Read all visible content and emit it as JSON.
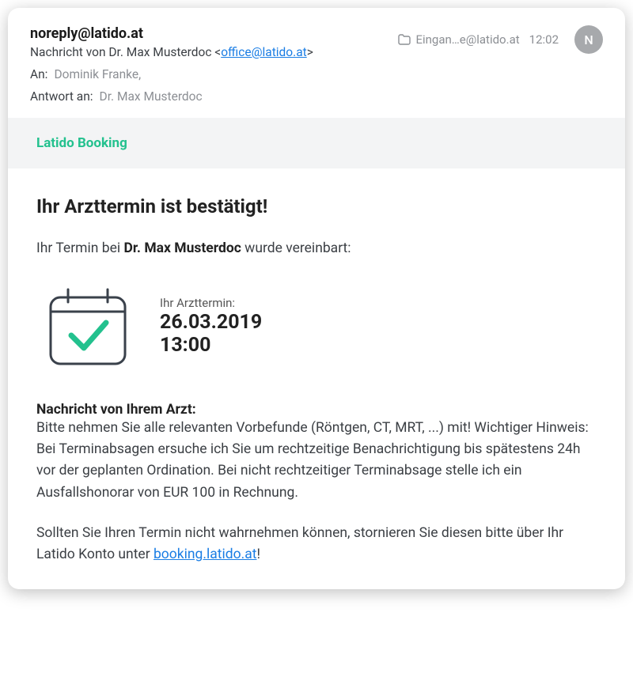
{
  "header": {
    "sender": "noreply@latido.at",
    "subject_prefix": "Nachricht von Dr. Max Musterdoc <",
    "subject_email": "office@latido.at",
    "subject_suffix": ">",
    "to_label": "An:",
    "to_value": "Dominik Franke,",
    "reply_label": "Antwort an:",
    "reply_value": "Dr. Max Musterdoc",
    "folder": "Eingan…e@latido.at",
    "time": "12:02",
    "avatar_initial": "N"
  },
  "brand": "Latido Booking",
  "body": {
    "title": "Ihr Arzttermin ist bestätigt!",
    "intro_before": "Ihr Termin bei ",
    "intro_bold": "Dr. Max Musterdoc",
    "intro_after": " wurde vereinbart:",
    "appointment": {
      "label": "Ihr Arzttermin:",
      "date": "26.03.2019",
      "time": "13:00"
    },
    "doctor_msg_label": "Nachricht von Ihrem Arzt:",
    "doctor_msg_body": "Bitte nehmen Sie alle relevanten Vorbefunde (Röntgen, CT, MRT, ...) mit! Wichtiger Hinweis: Bei Terminabsagen ersuche ich Sie um rechtzeitige Benachrichtigung bis spätestens 24h vor der geplanten Ordination. Bei nicht rechtzeitiger Terminabsage stelle ich ein Ausfallshonorar von EUR 100 in Rechnung.",
    "cancel_before": "Sollten Sie Ihren Termin nicht wahrnehmen können, stornieren Sie diesen bitte über Ihr Latido Konto unter ",
    "cancel_link": "booking.latido.at",
    "cancel_after": "!"
  }
}
